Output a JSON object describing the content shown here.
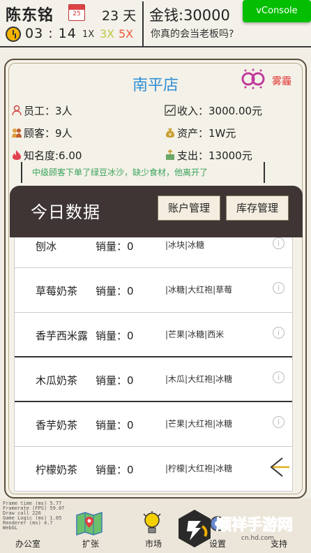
{
  "header": {
    "player_name": "陈东铭",
    "calendar_day": "25",
    "days_label": "23 天",
    "time": "03 : 14",
    "speed_1": "1X",
    "speed_3": "3X",
    "speed_5": "5X",
    "money": "金钱:30000",
    "question": "你真的会当老板吗?",
    "vconsole": "vConsole"
  },
  "shop": {
    "name": "南平店",
    "weather": "雾霾",
    "employees": "员工：3人",
    "income": "收入：3000.00元",
    "customers": "顾客：9人",
    "assets": "资产：1W元",
    "fame": "知名度:6.00",
    "expense": "支出：13000元",
    "message": "中级顾客下单了绿豆冰沙，缺少食材，他离开了"
  },
  "panel": {
    "title": "今日数据",
    "btn_account": "账户管理",
    "btn_stock": "库存管理"
  },
  "products": [
    {
      "name": "刨冰",
      "sales": "销量：0",
      "ingredients": "|冰块|冰糖"
    },
    {
      "name": "草莓奶茶",
      "sales": "销量：0",
      "ingredients": "|冰糖|大红袍|草莓"
    },
    {
      "name": "香芋西米露",
      "sales": "销量：0",
      "ingredients": "|芒果|冰糖|西米"
    },
    {
      "name": "木瓜奶茶",
      "sales": "销量：0",
      "ingredients": "|木瓜|大红袍|冰糖"
    },
    {
      "name": "香芋奶茶",
      "sales": "销量：0",
      "ingredients": "|芒果|大红袍|冰糖"
    },
    {
      "name": "柠檬奶茶",
      "sales": "销量：0",
      "ingredients": "|柠檬|大红袍|冰糖"
    }
  ],
  "nav": {
    "office": "办公室",
    "expand": "扩张",
    "market": "市场",
    "settings": "设置",
    "support": "支持"
  },
  "debug": {
    "line1": "Frame time (ms)  5.77",
    "line2": "Framerate (FPS)  59.07",
    "line3": "Draw call        226",
    "line4": "Game Logic (ms)  1.05",
    "line5": "Renderer (ms)    4.7",
    "line6": "WebGL"
  },
  "watermark": {
    "text": "顺祥手游网",
    "url": "cn.hd.com"
  },
  "colors": {
    "shop_name": "#2f8fd6",
    "weather": "#e03030",
    "message": "#3aa35c",
    "vconsole": "#04be02",
    "speed3": "#b9cc44",
    "speed5": "#ef5a3c",
    "panel_header": "#3e3534"
  }
}
